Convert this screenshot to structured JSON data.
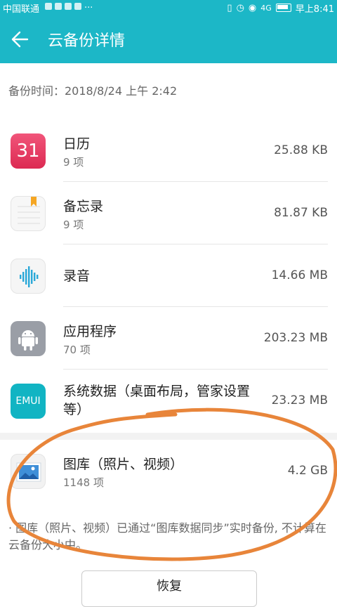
{
  "status_bar": {
    "carrier": "中国联通",
    "time": "早上8:41",
    "network": "4G"
  },
  "app_bar": {
    "title": "云备份详情"
  },
  "backup_time": "备份时间：2018/8/24 上午 2:42",
  "items": [
    {
      "name": "日历",
      "count": "9 项",
      "size": "25.88 KB",
      "icon": "calendar-icon",
      "icon_text": "31"
    },
    {
      "name": "备忘录",
      "count": "9 项",
      "size": "81.87 KB",
      "icon": "memo-icon"
    },
    {
      "name": "录音",
      "count": "",
      "size": "14.66 MB",
      "icon": "recorder-icon"
    },
    {
      "name": "应用程序",
      "count": "70 项",
      "size": "203.23 MB",
      "icon": "android-icon"
    },
    {
      "name": "系统数据（桌面布局，管家设置等）",
      "count": "",
      "size": "23.23 MB",
      "icon": "emui-icon",
      "icon_text": "EMUI"
    },
    {
      "name": "图库（照片、视频）",
      "count": "1148 项",
      "size": "4.2 GB",
      "icon": "gallery-icon"
    }
  ],
  "note": "· 图库（照片、视频）已通过“图库数据同步”实时备份, 不计算在云备份大小中。",
  "bottom_button": "恢复",
  "colors": {
    "accent": "#1cb7c7",
    "annotation": "#e8853a"
  }
}
